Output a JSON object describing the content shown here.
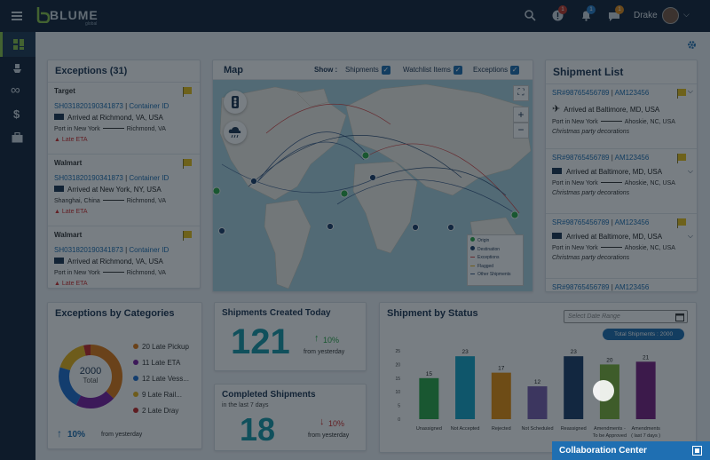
{
  "app": {
    "logo": "BLUME",
    "logo_sub": "global",
    "user_name": "Drake",
    "badges": {
      "alerts": "1",
      "notifications": "1",
      "messages": "1"
    }
  },
  "sidebar": {
    "items": [
      {
        "icon": "dashboard-icon"
      },
      {
        "icon": "ship-icon"
      },
      {
        "icon": "infinity-icon"
      },
      {
        "icon": "dollar-icon"
      },
      {
        "icon": "briefcase-icon"
      }
    ]
  },
  "exceptions": {
    "title": "Exceptions (31)",
    "items": [
      {
        "company": "Target",
        "id": "SH031820190341873",
        "container": "Container ID",
        "status": "Arrived at Richmond, VA, USA",
        "from": "Port in New York",
        "to": "Richmond, VA",
        "alert": "Late ETA"
      },
      {
        "company": "Walmart",
        "id": "SH031820190341873",
        "container": "Container ID",
        "status": "Arrived at New York, NY, USA",
        "from": "Shanghai, China",
        "to": "Richmond, VA",
        "alert": "Late ETA"
      },
      {
        "company": "Walmart",
        "id": "SH031820190341873",
        "container": "Container ID",
        "status": "Arrived at Richmond, VA, USA",
        "from": "Port in New York",
        "to": "Richmond, VA",
        "alert": "Late ETA"
      }
    ]
  },
  "map": {
    "title": "Map",
    "show_label": "Show :",
    "filters": [
      "Shipments",
      "Watchlist Items",
      "Exceptions"
    ],
    "legend": [
      "Origin",
      "Destination",
      "Exceptions",
      "Flagged",
      "Other Shipments"
    ]
  },
  "shipment_list": {
    "title": "Shipment List",
    "items": [
      {
        "ref": "SR#98765456789",
        "code": "AM123456",
        "status": "Arrived at Baltimore, MD, USA",
        "from": "Port in New York",
        "to": "Ahoskie, NC, USA",
        "note": "Christmas party decorations",
        "mode": "plane"
      },
      {
        "ref": "SR#98765456789",
        "code": "AM123456",
        "status": "Arrived at Baltimore, MD, USA",
        "from": "Port in New York",
        "to": "Ahoskie, NC, USA",
        "note": "Christmas party decorations",
        "mode": "truck"
      },
      {
        "ref": "SR#98765456789",
        "code": "AM123456",
        "status": "Arrived at Baltimore, MD, USA",
        "from": "Port in New York",
        "to": "Ahoskie, NC, USA",
        "note": "Christmas party decorations",
        "mode": "truck"
      },
      {
        "ref": "SR#98765456789",
        "code": "AM123456"
      }
    ]
  },
  "categories": {
    "title": "Exceptions by Categories",
    "total_value": "2000",
    "total_label": "Total",
    "legend": [
      {
        "label": "20 Late Pickup",
        "color": "#e07b18",
        "value": 20
      },
      {
        "label": "11 Late ETA",
        "color": "#7a1fa2",
        "value": 11
      },
      {
        "label": "12 Late Vess...",
        "color": "#1f6fd0",
        "value": 12
      },
      {
        "label": "9 Late Rail...",
        "color": "#e8b41a",
        "value": 9
      },
      {
        "label": "2 Late Dray",
        "color": "#c62828",
        "value": 2
      }
    ],
    "trend_value": "10%",
    "trend_text": "from yesterday"
  },
  "created": {
    "title": "Shipments Created Today",
    "value": "121",
    "trend_value": "10%",
    "trend_text": "from yesterday"
  },
  "completed": {
    "title": "Completed Shipments",
    "subtitle": "in the last 7 days",
    "value": "18",
    "trend_value": "10%",
    "trend_text": "from yesterday"
  },
  "status": {
    "title": "Shipment by Status",
    "date_placeholder": "Select Date Range",
    "total_pill": "Total Shipments : 2000"
  },
  "chart_data": {
    "type": "bar",
    "title": "Shipment by Status",
    "categories": [
      "Unassigned",
      "Not Accepted",
      "Rejected",
      "Not Scheduled",
      "Reassigned",
      "Amendments - To be Approved",
      "Amendments (last 7 days)"
    ],
    "category_lines": [
      [
        "Unassigned"
      ],
      [
        "Not Accepted"
      ],
      [
        "Rejected"
      ],
      [
        "Not Scheduled"
      ],
      [
        "Reassigned"
      ],
      [
        "Amendments -",
        "To be Approved"
      ],
      [
        "Amendments",
        "( last 7 days )"
      ]
    ],
    "values": [
      15,
      23,
      17,
      12,
      23,
      20,
      21
    ],
    "colors": [
      "#2ea84a",
      "#17a6c9",
      "#e8900f",
      "#7b5fb0",
      "#1d3f6b",
      "#7fb43a",
      "#7a2384"
    ],
    "ylim": [
      0,
      25
    ],
    "yticks": [
      0,
      5,
      10,
      15,
      20,
      25
    ]
  },
  "collab": {
    "label": "Collaboration Center"
  }
}
